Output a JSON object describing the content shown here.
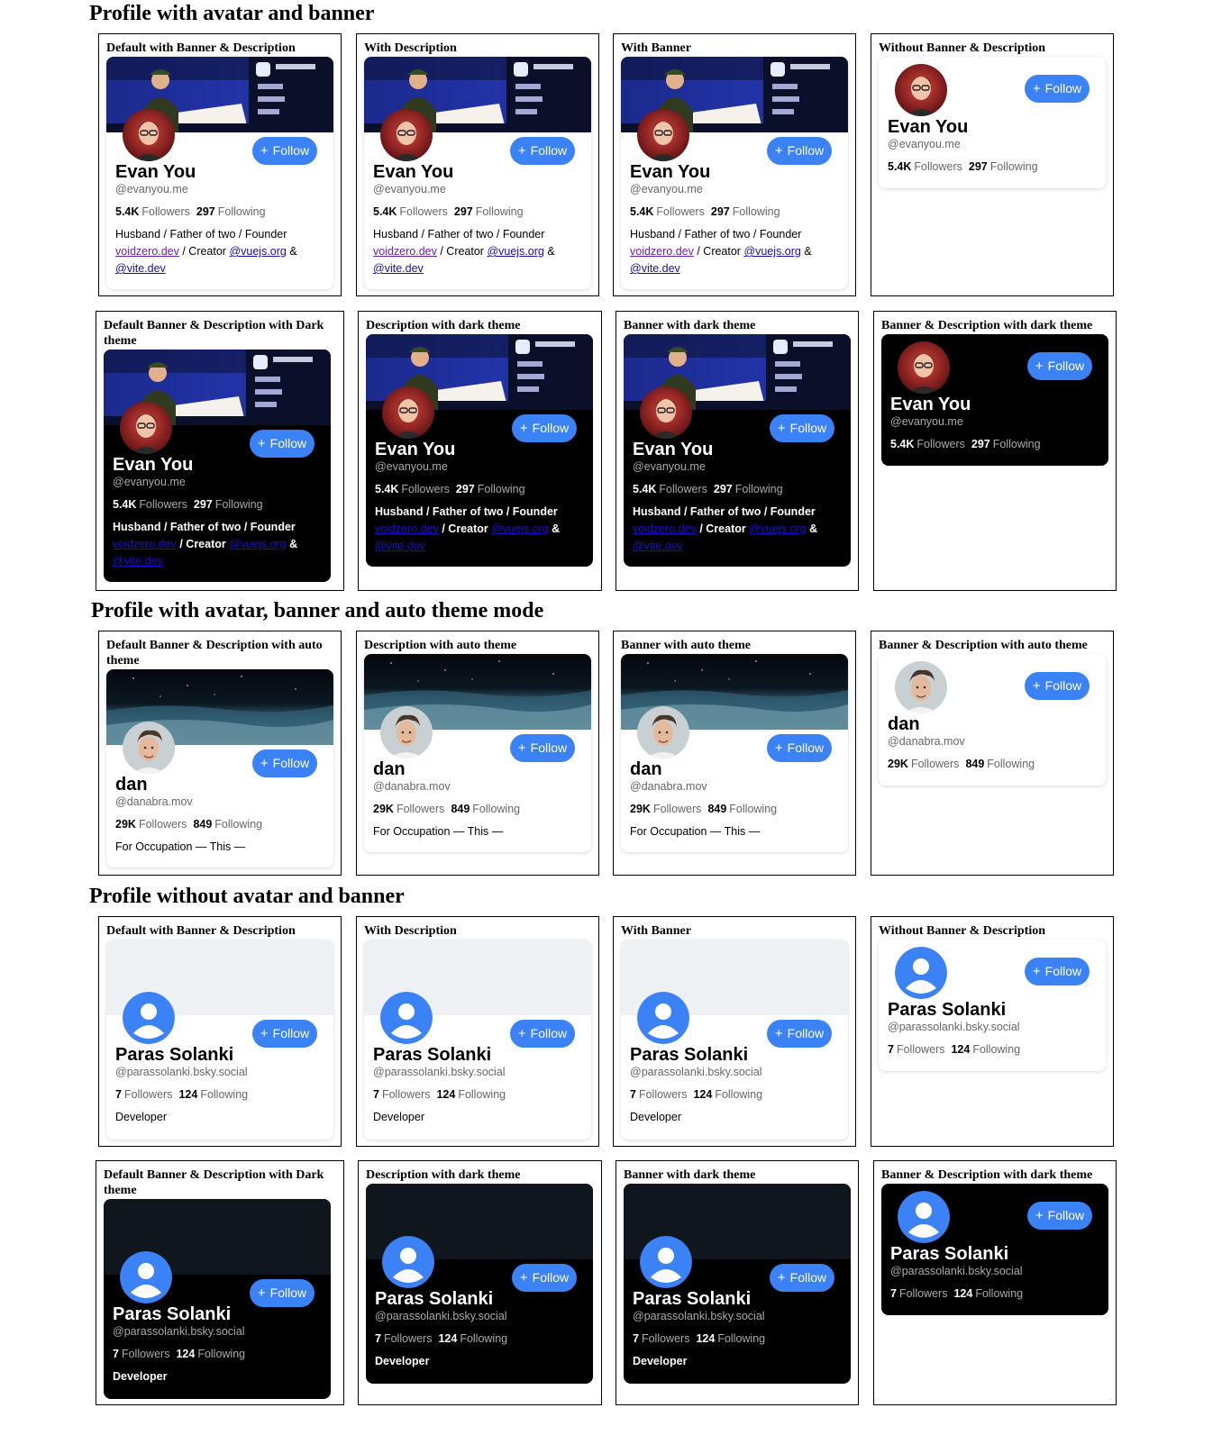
{
  "sections": {
    "s1": "Profile with avatar and banner",
    "s2": "Profile with avatar, banner and auto theme mode",
    "s3": "Profile without avatar and banner"
  },
  "colors": {
    "accent": "#3b82f6",
    "dark_card": "#000000",
    "placeholder_banner": "#eef1f4",
    "placeholder_banner_dark": "#0f161e"
  },
  "icons": {
    "follow": "plus-icon",
    "default_avatar": "user-icon"
  },
  "follow_label": "Follow",
  "followers_label": "Followers",
  "following_label": "Following",
  "boxes": [
    {
      "title": "Default with Banner & Description"
    },
    {
      "title": "With Description"
    },
    {
      "title": "With Banner"
    },
    {
      "title": "Without Banner & Description"
    },
    {
      "title": "Default Banner & Description with Dark theme"
    },
    {
      "title": "Description with dark theme"
    },
    {
      "title": "Banner with dark theme"
    },
    {
      "title": "Banner & Description with dark theme"
    },
    {
      "title": "Default Banner & Description with auto theme"
    },
    {
      "title": "Description with auto theme"
    },
    {
      "title": "Banner with auto theme"
    },
    {
      "title": "Banner & Description with auto theme"
    },
    {
      "title": "Default with Banner & Description"
    },
    {
      "title": "With Description"
    },
    {
      "title": "With Banner"
    },
    {
      "title": "Without Banner & Description"
    },
    {
      "title": "Default Banner & Description with Dark theme"
    },
    {
      "title": "Description with dark theme"
    },
    {
      "title": "Banner with dark theme"
    },
    {
      "title": "Banner & Description with dark theme"
    }
  ],
  "profiles": {
    "evan": {
      "name": "Evan You",
      "handle": "@evanyou.me",
      "followers": "5.4K",
      "following": "297",
      "desc_line1": "Husband / Father of two / Founder",
      "desc_link1": "voidzero.dev",
      "desc_creator": " / Creator ",
      "desc_link2": "@vuejs.org",
      "desc_amp": " &",
      "desc_link3": "@vite.dev"
    },
    "dan": {
      "name": "dan",
      "handle": "@danabra.mov",
      "followers": "29K",
      "following": "849",
      "description": "For Occupation — This —"
    },
    "paras": {
      "name": "Paras Solanki",
      "handle": "@parassolanki.bsky.social",
      "followers": "7",
      "following": "124",
      "description": "Developer"
    }
  }
}
